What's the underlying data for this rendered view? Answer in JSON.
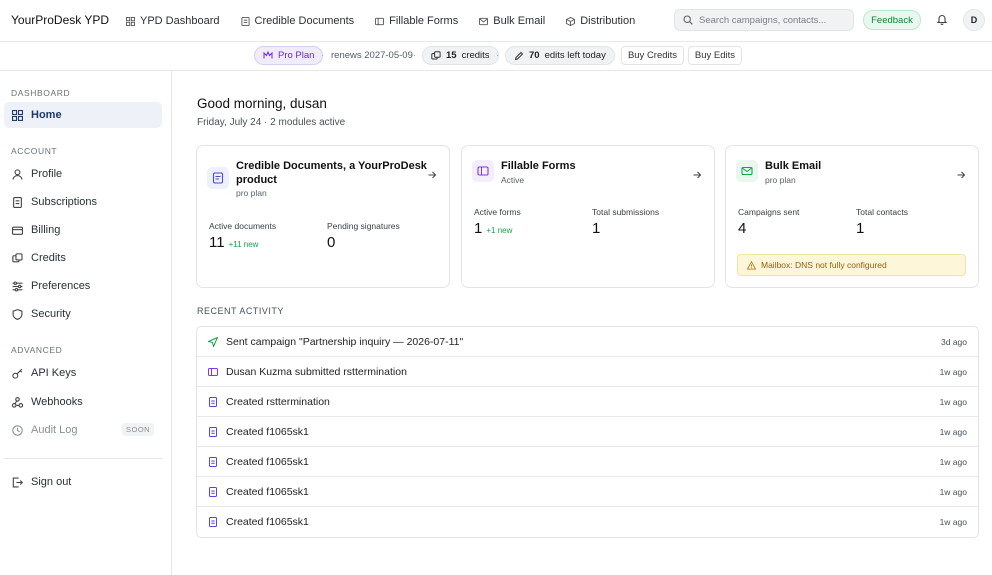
{
  "brand": {
    "name": "YourProDesk",
    "short": "YPD"
  },
  "nav": [
    {
      "label": "YPD Dashboard",
      "icon": "grid-icon"
    },
    {
      "label": "Credible Documents",
      "icon": "document-icon"
    },
    {
      "label": "Fillable Forms",
      "icon": "form-icon"
    },
    {
      "label": "Bulk Email",
      "icon": "mail-icon"
    },
    {
      "label": "Distribution",
      "icon": "package-icon"
    }
  ],
  "search": {
    "placeholder": "Search campaigns, contacts..."
  },
  "feedback_label": "Feedback",
  "user_initial": "D",
  "plan": {
    "plan_label": "Pro Plan",
    "renews": "renews 2027-05-09",
    "credits_count": "15",
    "credits_label": "credits",
    "edits_count": "70",
    "edits_label": "edits left today",
    "buy_credits": "Buy Credits",
    "buy_edits": "Buy Edits"
  },
  "sidebar": {
    "sections": [
      "DASHBOARD",
      "ACCOUNT",
      "ADVANCED"
    ],
    "home": "Home",
    "account_items": [
      "Profile",
      "Subscriptions",
      "Billing",
      "Credits",
      "Preferences",
      "Security"
    ],
    "advanced_items": [
      "API Keys",
      "Webhooks",
      "Audit Log"
    ],
    "soon_badge": "SOON",
    "sign_out": "Sign out"
  },
  "greeting": {
    "title": "Good morning, dusan",
    "subtitle": "Friday, July 24 · 2 modules active"
  },
  "cards": [
    {
      "title_line1": "Credible Documents, a YourProDesk",
      "title_line2": "product",
      "status": "pro plan",
      "stat1_label": "Active documents",
      "stat1_value": "11",
      "stat1_new": "+11 new",
      "stat2_label": "Pending signatures",
      "stat2_value": "0",
      "accent": "#4f46e5"
    },
    {
      "title_line1": "Fillable Forms",
      "status": "Active",
      "stat1_label": "Active forms",
      "stat1_value": "1",
      "stat1_new": "+1 new",
      "stat2_label": "Total submissions",
      "stat2_value": "1",
      "accent": "#7c3aed"
    },
    {
      "title_line1": "Bulk Email",
      "status": "pro plan",
      "stat1_label": "Campaigns sent",
      "stat1_value": "4",
      "stat2_label": "Total contacts",
      "stat2_value": "1",
      "warning": "Mailbox: DNS not fully configured",
      "accent": "#16a34a"
    }
  ],
  "recent": {
    "title": "RECENT ACTIVITY",
    "items": [
      {
        "text": "Sent campaign \"Partnership inquiry — 2026-07-11\"",
        "time": "3d ago",
        "icon": "send-icon"
      },
      {
        "text": "Dusan Kuzma submitted rsttermination",
        "time": "1w ago",
        "icon": "form-icon"
      },
      {
        "text": "Created rsttermination",
        "time": "1w ago",
        "icon": "document-icon"
      },
      {
        "text": "Created f1065sk1",
        "time": "1w ago",
        "icon": "document-icon"
      },
      {
        "text": "Created f1065sk1",
        "time": "1w ago",
        "icon": "document-icon"
      },
      {
        "text": "Created f1065sk1",
        "time": "1w ago",
        "icon": "document-icon"
      },
      {
        "text": "Created f1065sk1",
        "time": "1w ago",
        "icon": "document-icon"
      }
    ]
  }
}
